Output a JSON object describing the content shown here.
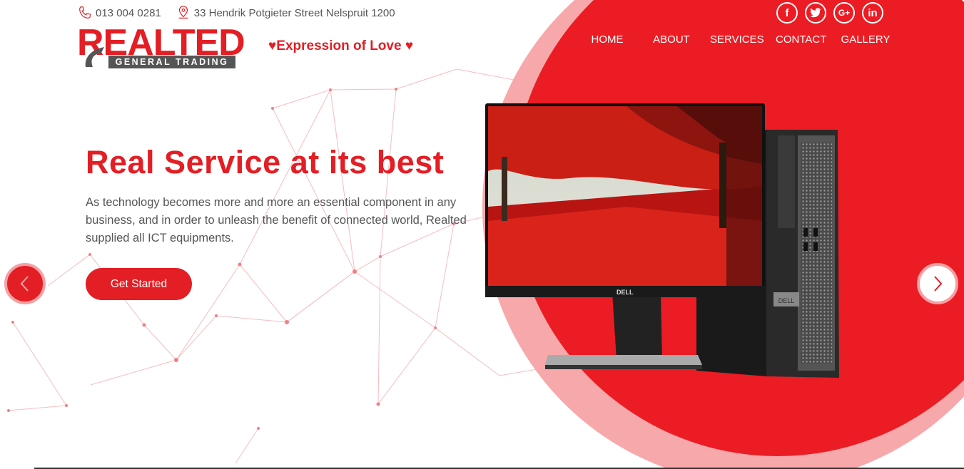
{
  "contact": {
    "phone": "013 004 0281",
    "address": "33 Hendrik Potgieter Street Nelspruit 1200"
  },
  "logo": {
    "main": "REALTED",
    "sub": "GENERAL TRADING"
  },
  "tagline": "♥Expression of Love ♥",
  "social": [
    {
      "label": "f",
      "icon": "facebook-icon"
    },
    {
      "label": "t",
      "icon": "twitter-icon"
    },
    {
      "label": "G+",
      "icon": "google-plus-icon"
    },
    {
      "label": "in",
      "icon": "linkedin-icon"
    }
  ],
  "nav": [
    "HOME",
    "ABOUT",
    "SERVICES",
    "CONTACT",
    "GALLERY"
  ],
  "hero": {
    "title": "Real Service at its best",
    "text": "As technology becomes more and more an essential component in any business, and in order to unleash the benefit of connected world, Realted supplied all ICT equipments.",
    "button": "Get Started"
  },
  "product_brand": "DELL",
  "colors": {
    "accent": "#e31e24",
    "accent_light": "#f5a0a3",
    "text": "#555555",
    "white": "#ffffff"
  }
}
